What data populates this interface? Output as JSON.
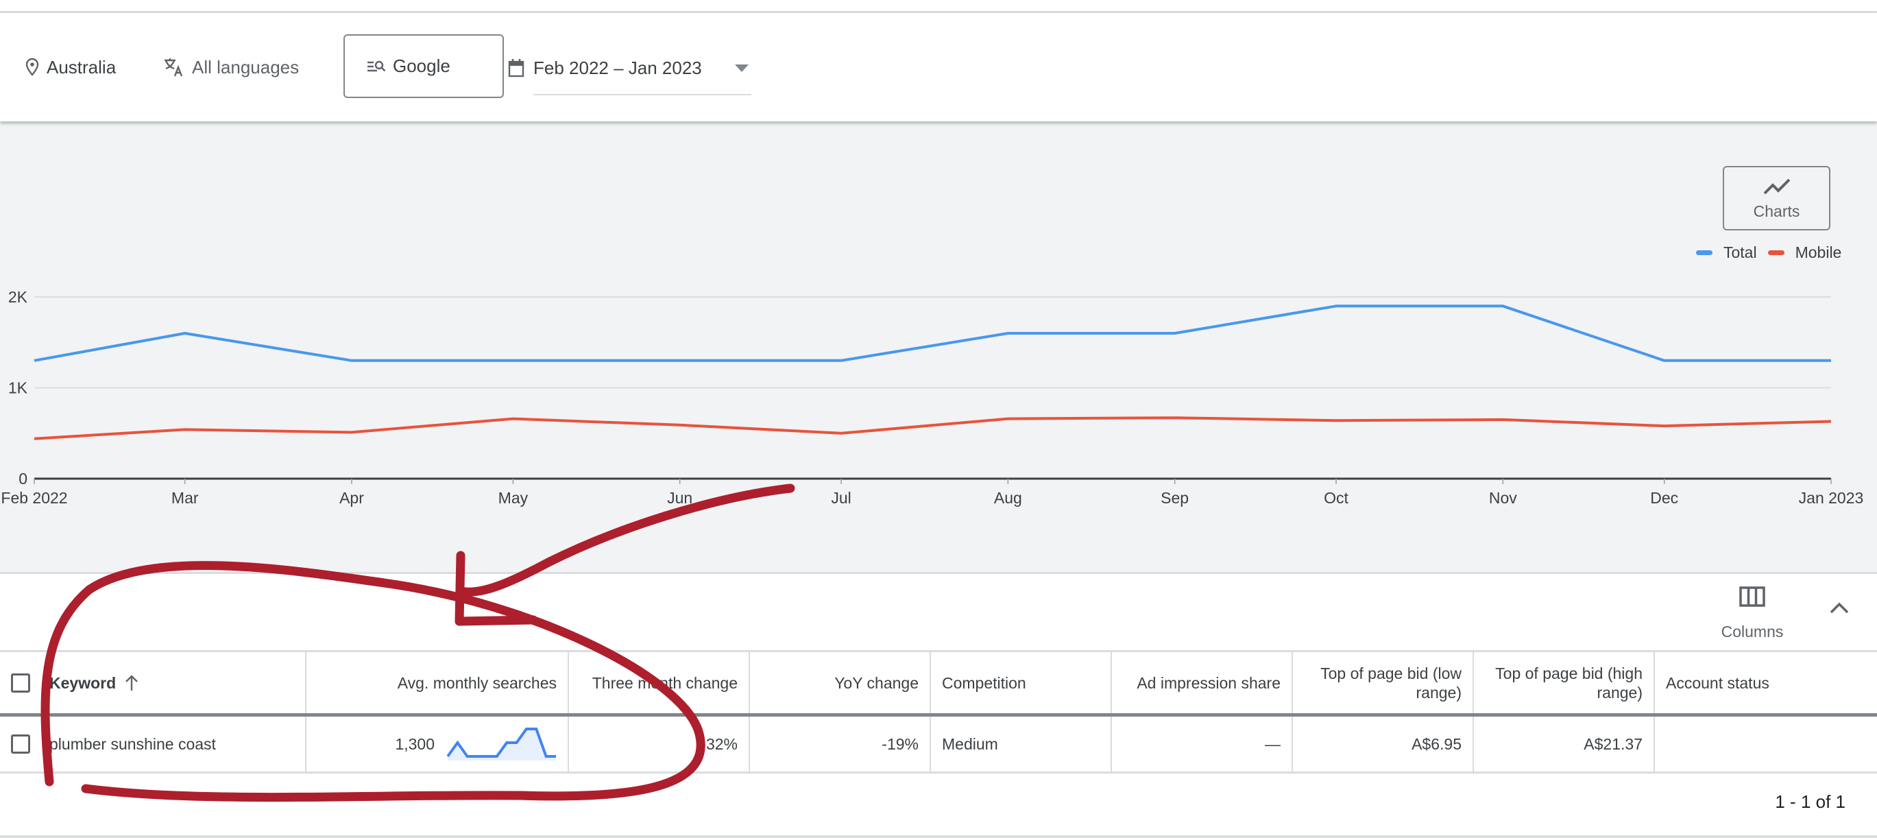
{
  "filters": {
    "location": {
      "icon": "location-pin-icon",
      "label": "Australia"
    },
    "language": {
      "icon": "translate-icon",
      "label": "All languages"
    },
    "network": {
      "icon": "search-network-icon",
      "label": "Google"
    },
    "date_range": {
      "icon": "calendar-icon",
      "label": "Feb 2022 – Jan 2023"
    }
  },
  "chart_panel": {
    "charts_button_label": "Charts",
    "colors": {
      "total": "#4a97ec",
      "mobile": "#e8533d"
    }
  },
  "chart_data": {
    "type": "line",
    "title": "",
    "xlabel": "",
    "ylabel": "",
    "x": [
      "Feb 2022",
      "Mar",
      "Apr",
      "May",
      "Jun",
      "Jul",
      "Aug",
      "Sep",
      "Oct",
      "Nov",
      "Dec",
      "Jan 2023"
    ],
    "series": [
      {
        "name": "Total",
        "color": "#4a97ec",
        "values": [
          1300,
          1600,
          1300,
          1300,
          1300,
          1300,
          1600,
          1600,
          1900,
          1900,
          1300,
          1300
        ]
      },
      {
        "name": "Mobile",
        "color": "#e8533d",
        "values": [
          440,
          540,
          510,
          660,
          590,
          500,
          660,
          670,
          640,
          650,
          580,
          630
        ]
      }
    ],
    "yticks": [
      {
        "value": 0,
        "label": "0"
      },
      {
        "value": 1000,
        "label": "1K"
      },
      {
        "value": 2000,
        "label": "2K"
      }
    ],
    "ylim": [
      0,
      2000
    ],
    "grid": true,
    "legend": "top-right"
  },
  "table_toolbar": {
    "columns_label": "Columns"
  },
  "table": {
    "headers": {
      "keyword": "Keyword",
      "avg_monthly": "Avg. monthly searches",
      "three_month": "Three month change",
      "yoy": "YoY change",
      "competition": "Competition",
      "ad_impression": "Ad impression share",
      "bid_low": "Top of page bid (low range)",
      "bid_high": "Top of page bid (high range)",
      "account_status": "Account status"
    },
    "rows": [
      {
        "keyword": "plumber sunshine coast",
        "avg_monthly": "1,300",
        "trend": [
          1300,
          1600,
          1300,
          1300,
          1300,
          1300,
          1600,
          1600,
          1900,
          1900,
          1300,
          1300
        ],
        "three_month": "-32%",
        "yoy": "-19%",
        "competition": "Medium",
        "ad_impression": "—",
        "bid_low": "A$6.95",
        "bid_high": "A$21.37",
        "account_status": ""
      }
    ]
  },
  "pagination": {
    "label": "1 - 1 of 1"
  },
  "annotation": {
    "color": "#ad1f2d"
  }
}
